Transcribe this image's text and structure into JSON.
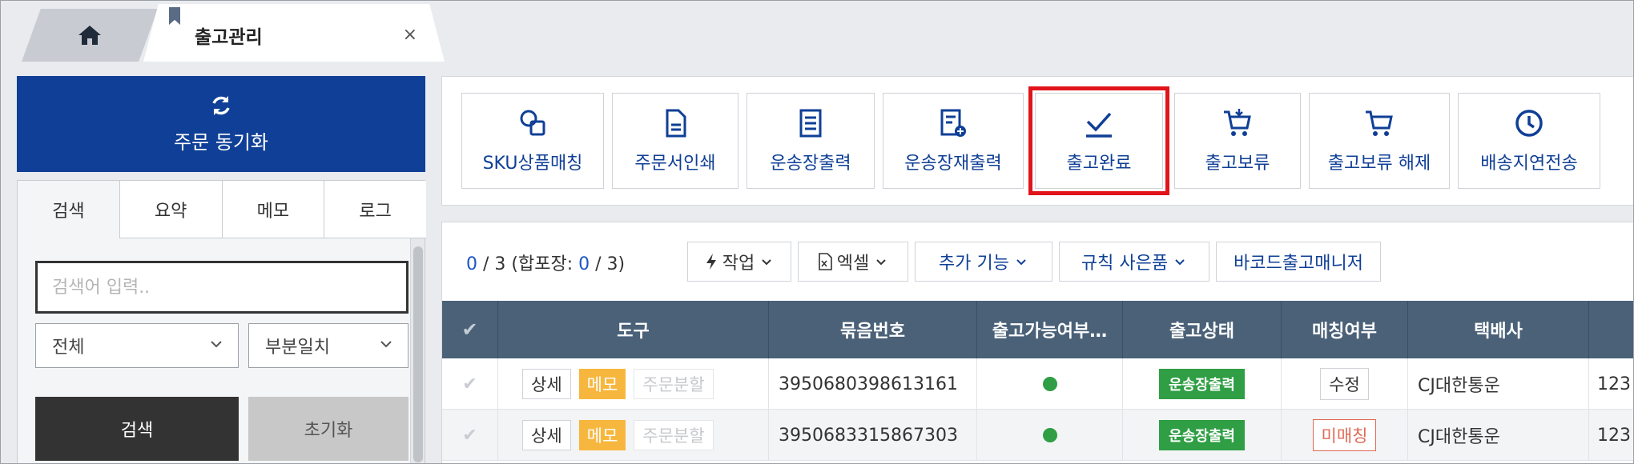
{
  "tabs": {
    "home_icon": "home-icon",
    "active_title": "출고관리",
    "close": "×"
  },
  "left": {
    "sync_label": "주문 동기화",
    "panel_tabs": [
      "검색",
      "요약",
      "메모",
      "로그"
    ],
    "search_placeholder": "검색어 입력..",
    "scope_select": "전체",
    "match_select": "부분일치",
    "search_button": "검색",
    "reset_button": "초기화"
  },
  "toolbar": {
    "buttons": [
      {
        "label": "SKU상품매칭",
        "icon": "sku-match-icon"
      },
      {
        "label": "주문서인쇄",
        "icon": "document-icon"
      },
      {
        "label": "운송장출력",
        "icon": "list-icon"
      },
      {
        "label": "운송장재출력",
        "icon": "reprint-icon"
      },
      {
        "label": "출고완료",
        "icon": "check-icon"
      },
      {
        "label": "출고보류",
        "icon": "cart-hold-icon"
      },
      {
        "label": "출고보류 해제",
        "icon": "cart-release-icon"
      },
      {
        "label": "배송지연전송",
        "icon": "clock-icon"
      }
    ],
    "highlight_color": "#e0141a"
  },
  "list": {
    "count_selected": "0",
    "count_sep1": " / ",
    "count_total": "3",
    "count_combined_prefix": " (합포장: ",
    "count_combined_selected": "0",
    "count_combined_sep": " / ",
    "count_combined_total": "3)",
    "work_button": "작업",
    "excel_button": "엑셀",
    "extra_button": "추가 기능",
    "gift_button": "규칙 사은품",
    "barcode_button": "바코드출고매니저"
  },
  "table": {
    "headers": [
      "도구",
      "묶음번호",
      "출고가능여부…",
      "출고상태",
      "매칭여부",
      "택배사"
    ],
    "rows": [
      {
        "detail": "상세",
        "memo": "메모",
        "split": "주문분할",
        "bundle": "3950680398613161",
        "status": "운송장출력",
        "match": "수정",
        "carrier": "CJ대한통운",
        "more": "123"
      },
      {
        "detail": "상세",
        "memo": "메모",
        "split": "주문분할",
        "bundle": "3950683315867303",
        "status": "운송장출력",
        "match": "미매칭",
        "carrier": "CJ대한통운",
        "more": "123"
      }
    ]
  },
  "colors": {
    "brand_blue": "#0f3f96",
    "header_slate": "#4a6178",
    "status_green": "#2f9e44",
    "memo_orange": "#f7b73e",
    "unmatched_red": "#e06a56"
  }
}
